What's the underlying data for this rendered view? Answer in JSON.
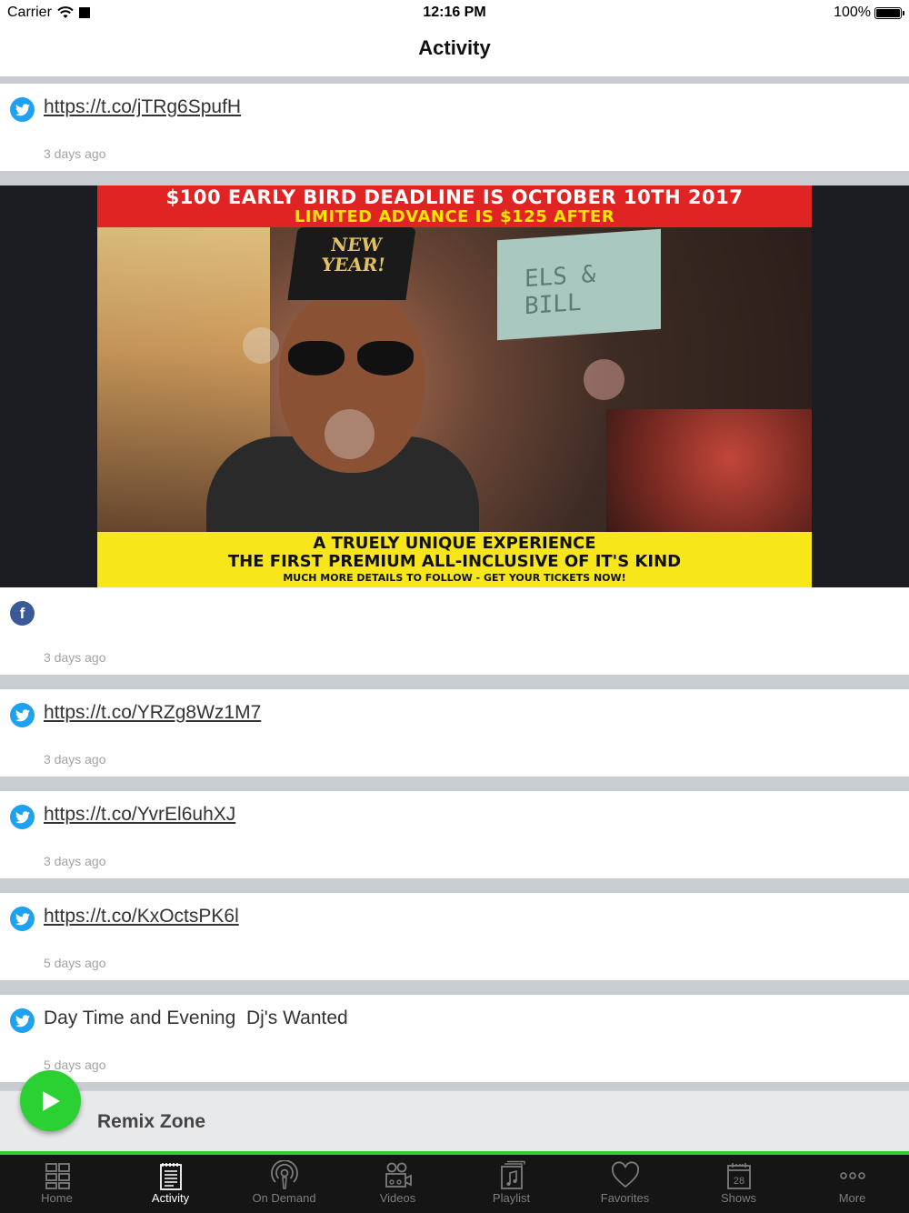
{
  "status_bar": {
    "carrier": "Carrier",
    "time": "12:16 PM",
    "battery": "100%"
  },
  "nav": {
    "title": "Activity"
  },
  "posts": [
    {
      "source": "twitter",
      "text": "https://t.co/jTRg6SpufH",
      "time": "3 days ago"
    },
    {
      "source": "facebook",
      "text": "",
      "time": "3 days ago"
    },
    {
      "source": "twitter",
      "text": "https://t.co/YRZg8Wz1M7",
      "time": "3 days ago"
    },
    {
      "source": "twitter",
      "text": "https://t.co/YvrEl6uhXJ",
      "time": "3 days ago"
    },
    {
      "source": "twitter",
      "text": "https://t.co/KxOctsPK6l",
      "time": "5 days ago"
    },
    {
      "source": "twitter",
      "text": "Day Time and Evening  Dj's Wanted",
      "time": "5 days ago"
    }
  ],
  "promo_image": {
    "top_line1": "$100 EARLY BIRD DEADLINE IS OCTOBER 10TH 2017",
    "top_line2": "LIMITED ADVANCE IS $125 AFTER",
    "hat_text": "NEW YEAR!",
    "screen_text": "ELS & BILL",
    "bottom_line1": "A TRUELY UNIQUE EXPERIENCE",
    "bottom_line2": "THE FIRST PREMIUM ALL-INCLUSIVE OF IT'S KIND",
    "bottom_line3": "MUCH MORE DETAILS TO FOLLOW - GET YOUR TICKETS NOW!"
  },
  "player": {
    "title": "Remix Zone",
    "accent_color": "#2bd132"
  },
  "tabs": [
    {
      "label": "Home",
      "icon": "home-grid-icon",
      "active": false
    },
    {
      "label": "Activity",
      "icon": "activity-list-icon",
      "active": true
    },
    {
      "label": "On Demand",
      "icon": "podcast-icon",
      "active": false
    },
    {
      "label": "Videos",
      "icon": "video-camera-icon",
      "active": false
    },
    {
      "label": "Playlist",
      "icon": "playlist-music-icon",
      "active": false
    },
    {
      "label": "Favorites",
      "icon": "heart-icon",
      "active": false
    },
    {
      "label": "Shows",
      "icon": "calendar-icon",
      "active": false,
      "badge": "28"
    },
    {
      "label": "More",
      "icon": "more-dots-icon",
      "active": false
    }
  ]
}
